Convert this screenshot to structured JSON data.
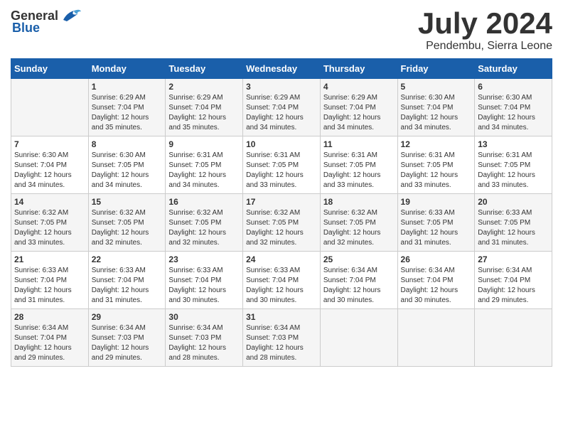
{
  "header": {
    "logo_general": "General",
    "logo_blue": "Blue",
    "month_title": "July 2024",
    "location": "Pendembu, Sierra Leone"
  },
  "weekdays": [
    "Sunday",
    "Monday",
    "Tuesday",
    "Wednesday",
    "Thursday",
    "Friday",
    "Saturday"
  ],
  "weeks": [
    [
      {
        "day": "",
        "sunrise": "",
        "sunset": "",
        "daylight": ""
      },
      {
        "day": "1",
        "sunrise": "Sunrise: 6:29 AM",
        "sunset": "Sunset: 7:04 PM",
        "daylight": "Daylight: 12 hours and 35 minutes."
      },
      {
        "day": "2",
        "sunrise": "Sunrise: 6:29 AM",
        "sunset": "Sunset: 7:04 PM",
        "daylight": "Daylight: 12 hours and 35 minutes."
      },
      {
        "day": "3",
        "sunrise": "Sunrise: 6:29 AM",
        "sunset": "Sunset: 7:04 PM",
        "daylight": "Daylight: 12 hours and 34 minutes."
      },
      {
        "day": "4",
        "sunrise": "Sunrise: 6:29 AM",
        "sunset": "Sunset: 7:04 PM",
        "daylight": "Daylight: 12 hours and 34 minutes."
      },
      {
        "day": "5",
        "sunrise": "Sunrise: 6:30 AM",
        "sunset": "Sunset: 7:04 PM",
        "daylight": "Daylight: 12 hours and 34 minutes."
      },
      {
        "day": "6",
        "sunrise": "Sunrise: 6:30 AM",
        "sunset": "Sunset: 7:04 PM",
        "daylight": "Daylight: 12 hours and 34 minutes."
      }
    ],
    [
      {
        "day": "7",
        "sunrise": "Sunrise: 6:30 AM",
        "sunset": "Sunset: 7:04 PM",
        "daylight": "Daylight: 12 hours and 34 minutes."
      },
      {
        "day": "8",
        "sunrise": "Sunrise: 6:30 AM",
        "sunset": "Sunset: 7:05 PM",
        "daylight": "Daylight: 12 hours and 34 minutes."
      },
      {
        "day": "9",
        "sunrise": "Sunrise: 6:31 AM",
        "sunset": "Sunset: 7:05 PM",
        "daylight": "Daylight: 12 hours and 34 minutes."
      },
      {
        "day": "10",
        "sunrise": "Sunrise: 6:31 AM",
        "sunset": "Sunset: 7:05 PM",
        "daylight": "Daylight: 12 hours and 33 minutes."
      },
      {
        "day": "11",
        "sunrise": "Sunrise: 6:31 AM",
        "sunset": "Sunset: 7:05 PM",
        "daylight": "Daylight: 12 hours and 33 minutes."
      },
      {
        "day": "12",
        "sunrise": "Sunrise: 6:31 AM",
        "sunset": "Sunset: 7:05 PM",
        "daylight": "Daylight: 12 hours and 33 minutes."
      },
      {
        "day": "13",
        "sunrise": "Sunrise: 6:31 AM",
        "sunset": "Sunset: 7:05 PM",
        "daylight": "Daylight: 12 hours and 33 minutes."
      }
    ],
    [
      {
        "day": "14",
        "sunrise": "Sunrise: 6:32 AM",
        "sunset": "Sunset: 7:05 PM",
        "daylight": "Daylight: 12 hours and 33 minutes."
      },
      {
        "day": "15",
        "sunrise": "Sunrise: 6:32 AM",
        "sunset": "Sunset: 7:05 PM",
        "daylight": "Daylight: 12 hours and 32 minutes."
      },
      {
        "day": "16",
        "sunrise": "Sunrise: 6:32 AM",
        "sunset": "Sunset: 7:05 PM",
        "daylight": "Daylight: 12 hours and 32 minutes."
      },
      {
        "day": "17",
        "sunrise": "Sunrise: 6:32 AM",
        "sunset": "Sunset: 7:05 PM",
        "daylight": "Daylight: 12 hours and 32 minutes."
      },
      {
        "day": "18",
        "sunrise": "Sunrise: 6:32 AM",
        "sunset": "Sunset: 7:05 PM",
        "daylight": "Daylight: 12 hours and 32 minutes."
      },
      {
        "day": "19",
        "sunrise": "Sunrise: 6:33 AM",
        "sunset": "Sunset: 7:05 PM",
        "daylight": "Daylight: 12 hours and 31 minutes."
      },
      {
        "day": "20",
        "sunrise": "Sunrise: 6:33 AM",
        "sunset": "Sunset: 7:05 PM",
        "daylight": "Daylight: 12 hours and 31 minutes."
      }
    ],
    [
      {
        "day": "21",
        "sunrise": "Sunrise: 6:33 AM",
        "sunset": "Sunset: 7:04 PM",
        "daylight": "Daylight: 12 hours and 31 minutes."
      },
      {
        "day": "22",
        "sunrise": "Sunrise: 6:33 AM",
        "sunset": "Sunset: 7:04 PM",
        "daylight": "Daylight: 12 hours and 31 minutes."
      },
      {
        "day": "23",
        "sunrise": "Sunrise: 6:33 AM",
        "sunset": "Sunset: 7:04 PM",
        "daylight": "Daylight: 12 hours and 30 minutes."
      },
      {
        "day": "24",
        "sunrise": "Sunrise: 6:33 AM",
        "sunset": "Sunset: 7:04 PM",
        "daylight": "Daylight: 12 hours and 30 minutes."
      },
      {
        "day": "25",
        "sunrise": "Sunrise: 6:34 AM",
        "sunset": "Sunset: 7:04 PM",
        "daylight": "Daylight: 12 hours and 30 minutes."
      },
      {
        "day": "26",
        "sunrise": "Sunrise: 6:34 AM",
        "sunset": "Sunset: 7:04 PM",
        "daylight": "Daylight: 12 hours and 30 minutes."
      },
      {
        "day": "27",
        "sunrise": "Sunrise: 6:34 AM",
        "sunset": "Sunset: 7:04 PM",
        "daylight": "Daylight: 12 hours and 29 minutes."
      }
    ],
    [
      {
        "day": "28",
        "sunrise": "Sunrise: 6:34 AM",
        "sunset": "Sunset: 7:04 PM",
        "daylight": "Daylight: 12 hours and 29 minutes."
      },
      {
        "day": "29",
        "sunrise": "Sunrise: 6:34 AM",
        "sunset": "Sunset: 7:03 PM",
        "daylight": "Daylight: 12 hours and 29 minutes."
      },
      {
        "day": "30",
        "sunrise": "Sunrise: 6:34 AM",
        "sunset": "Sunset: 7:03 PM",
        "daylight": "Daylight: 12 hours and 28 minutes."
      },
      {
        "day": "31",
        "sunrise": "Sunrise: 6:34 AM",
        "sunset": "Sunset: 7:03 PM",
        "daylight": "Daylight: 12 hours and 28 minutes."
      },
      {
        "day": "",
        "sunrise": "",
        "sunset": "",
        "daylight": ""
      },
      {
        "day": "",
        "sunrise": "",
        "sunset": "",
        "daylight": ""
      },
      {
        "day": "",
        "sunrise": "",
        "sunset": "",
        "daylight": ""
      }
    ]
  ]
}
